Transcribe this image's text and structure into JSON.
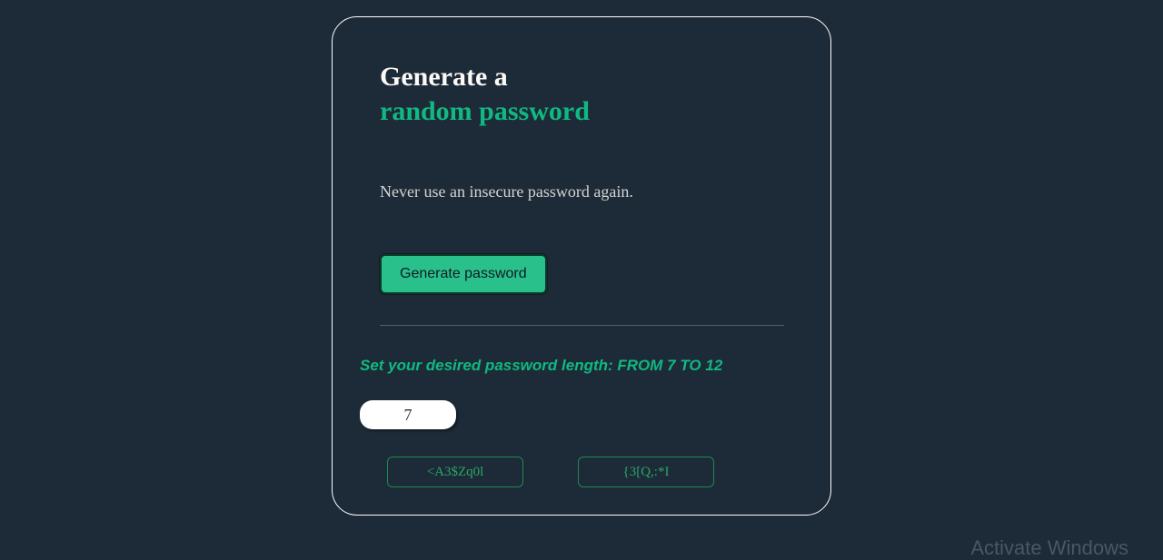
{
  "title": {
    "line1": "Generate a",
    "line2": "random password"
  },
  "subtitle": "Never use an insecure password again.",
  "generate_button_label": "Generate password",
  "length_prompt": "Set your desired password length: FROM 7 TO 12",
  "length_value": "7",
  "outputs": {
    "first": "<A3$Zq0l",
    "second": "{3[Q,:*I"
  },
  "watermark": {
    "title": "Activate Windows"
  }
}
